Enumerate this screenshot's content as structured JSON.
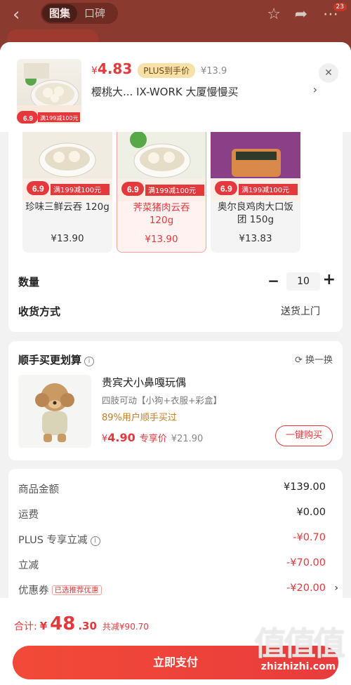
{
  "bg_header": {
    "tabs": [
      "图集",
      "口碑"
    ],
    "badge": "23"
  },
  "summary": {
    "currency": "¥",
    "price": "4.83",
    "plus_tag": "PLUS到手价",
    "orig_price": "¥13.9",
    "address": "樱桃大...  IX-WORK 大厦慢慢买",
    "promo_price": "6.9",
    "promo_text": "满199减100元"
  },
  "variants": [
    {
      "name": "珍味三鲜云吞 120g",
      "price": "¥13.90",
      "promo_price": "6.9",
      "promo_text": "满199减100元"
    },
    {
      "name": "荠菜猪肉云吞 120g",
      "price": "¥13.90",
      "promo_price": "6.9",
      "promo_text": "满199减100元"
    },
    {
      "name": "奥尔良鸡肉大口饭团 150g",
      "price": "¥13.83",
      "promo_price": "6.9",
      "promo_text": "满199减100元"
    }
  ],
  "quantity": {
    "label": "数量",
    "value": "10",
    "minus": "−",
    "plus": "+"
  },
  "shipping": {
    "label": "收货方式",
    "value": "送货上门"
  },
  "addon": {
    "title": "顺手买更划算",
    "swap": "换一换",
    "name": "贵宾犬小鼻嘎玩偶",
    "spec": "四肢可动【小狗+衣服+彩盒】",
    "rate": "89%用户顺手买过",
    "currency": "¥",
    "price": "4.90",
    "price_tag": "专享价",
    "orig_price": "¥21.90",
    "buy": "一键购买"
  },
  "fees": [
    {
      "label": "商品金额",
      "value": "¥139.00",
      "red": false
    },
    {
      "label": "运费",
      "value": "¥0.00",
      "red": false
    },
    {
      "label": "PLUS 专享立减",
      "value": "-¥0.70",
      "red": true,
      "info": true
    },
    {
      "label": "立减",
      "value": "-¥70.00",
      "red": true
    },
    {
      "label": "优惠券",
      "value": "-¥20.00",
      "red": true,
      "tag": "已选推荐优惠"
    }
  ],
  "bottom": {
    "total_label": "合计:",
    "currency": "¥",
    "total_int": "48",
    "total_dec": ".30",
    "saved": "共减¥90.70",
    "pay": "立即支付"
  },
  "watermark": {
    "logo": "值值值",
    "url": "zhizhizhi.com"
  },
  "colors": {
    "accent": "#e4393c",
    "plus": "#f7e1a8",
    "rate": "#c77c1e"
  }
}
